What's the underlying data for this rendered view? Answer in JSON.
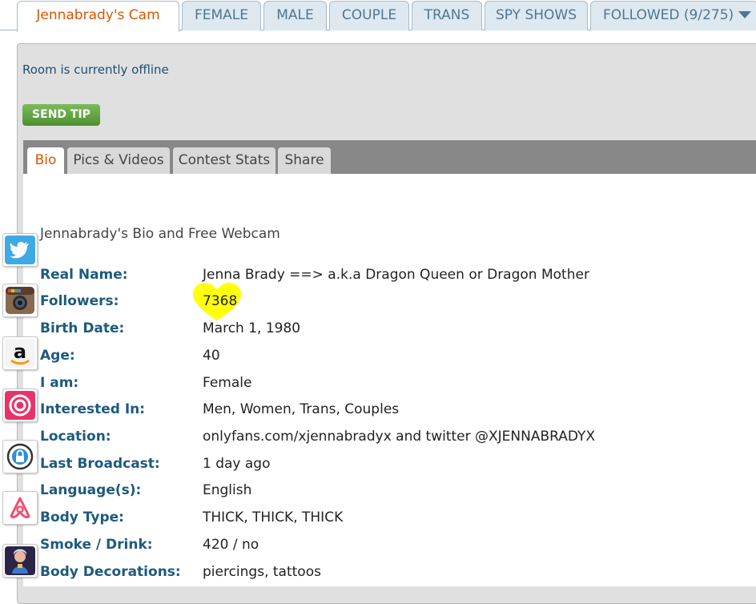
{
  "top_tabs": [
    {
      "label": "Jennabrady's Cam",
      "active": true
    },
    {
      "label": "FEMALE"
    },
    {
      "label": "MALE"
    },
    {
      "label": "COUPLE"
    },
    {
      "label": "TRANS"
    },
    {
      "label": "SPY SHOWS"
    },
    {
      "label": "FOLLOWED (9/275)"
    }
  ],
  "room": {
    "status_text": "Room is currently offline",
    "send_tip_label": "SEND TIP"
  },
  "sub_tabs": [
    {
      "label": "Bio",
      "active": true
    },
    {
      "label": "Pics & Videos"
    },
    {
      "label": "Contest Stats"
    },
    {
      "label": "Share"
    }
  ],
  "bio": {
    "title": "Jennabrady's Bio and Free Webcam",
    "rows": [
      {
        "label": "Real Name:",
        "value": "Jenna Brady ==> a.k.a Dragon Queen or Dragon Mother"
      },
      {
        "label": "Followers:",
        "value": "7368"
      },
      {
        "label": "Birth Date:",
        "value": "March 1, 1980"
      },
      {
        "label": "Age:",
        "value": "40"
      },
      {
        "label": "I am:",
        "value": "Female"
      },
      {
        "label": "Interested In:",
        "value": "Men, Women, Trans, Couples"
      },
      {
        "label": "Location:",
        "value": "onlyfans.com/xjennabradyx and twitter @XJENNABRADYX"
      },
      {
        "label": "Last Broadcast:",
        "value": "1 day ago"
      },
      {
        "label": "Language(s):",
        "value": "English"
      },
      {
        "label": "Body Type:",
        "value": "THICK, THICK, THICK"
      },
      {
        "label": "Smoke / Drink:",
        "value": "420 / no"
      },
      {
        "label": "Body Decorations:",
        "value": "piercings, tattoos"
      }
    ]
  },
  "social_icons": [
    "twitter-icon",
    "instagram-icon",
    "amazon-icon",
    "onlyfans-icon",
    "lock-icon",
    "airbnb-icon",
    "avatar-icon"
  ],
  "colors": {
    "active_tab_text": "#dc5500",
    "tab_text": "#4f7791",
    "label_text": "#1d5a7e",
    "send_tip_green": "#5fa23d",
    "heart_highlight": "#ffff00"
  }
}
